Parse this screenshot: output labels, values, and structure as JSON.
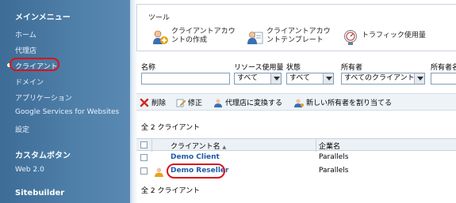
{
  "sidebar": {
    "main_menu_header": "メインメニュー",
    "items": [
      {
        "label": "ホーム"
      },
      {
        "label": "代理店"
      },
      {
        "label": "クライアント",
        "selected": true
      },
      {
        "label": "ドメイン"
      },
      {
        "label": "アプリケーション"
      },
      {
        "label": "Google Services for Websites"
      },
      {
        "label": "設定"
      }
    ],
    "custom_buttons_header": "カスタムボタン",
    "custom_items": [
      {
        "label": "Web 2.0"
      }
    ],
    "sitebuilder_header": "Sitebuilder"
  },
  "tools": {
    "title": "ツール",
    "items": [
      {
        "line1": "クライアントアカウ",
        "line2": "ントの作成",
        "icon": "create-client-account-icon"
      },
      {
        "line1": "クライアントアカウ",
        "line2": "ントテンプレート",
        "icon": "client-account-template-icon"
      },
      {
        "line1": "トラフィック使用量",
        "line2": "",
        "icon": "traffic-usage-icon"
      }
    ]
  },
  "filters": {
    "name_label": "名称",
    "resource_usage_label": "リソース使用量",
    "resource_usage_value": "すべて",
    "status_label": "状態",
    "status_value": "すべて",
    "owner_label": "所有者",
    "owner_value": "すべてのクライアント",
    "owner_name_label": "所有者名"
  },
  "actions": {
    "delete": "削除",
    "edit": "修正",
    "convert": "代理店に変換する",
    "assign_owner": "新しい所有者を割り当てる"
  },
  "table": {
    "count_top": "全 2 クライアント",
    "count_bottom": "全 2 クライアント",
    "col_client_name": "クライアント名",
    "sort_indicator": "▲",
    "col_company_name": "企業名",
    "rows": [
      {
        "client_name": "Demo Client",
        "company": "Parallels",
        "is_reseller": false
      },
      {
        "client_name": "Demo Reseller",
        "company": "Parallels",
        "is_reseller": true
      }
    ]
  },
  "colors": {
    "sidebar_bg": "#4e7fa9",
    "link": "#1f5aa8",
    "highlight_ring": "#d9121b"
  }
}
